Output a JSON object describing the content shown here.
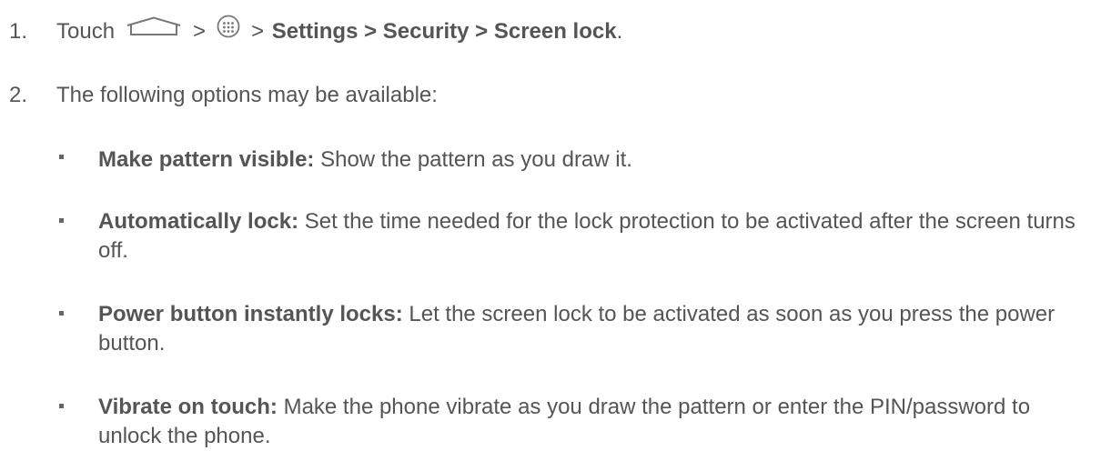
{
  "steps": [
    {
      "number": "1.",
      "prefix": "Touch",
      "sep1": ">",
      "sep2": ">",
      "path": "Settings > Security > Screen lock",
      "suffix": ".",
      "icons": [
        "home-icon",
        "apps-icon"
      ]
    },
    {
      "number": "2.",
      "text": "The following options may be available:"
    }
  ],
  "options": [
    {
      "term": "Make pattern visible:",
      "description": " Show the pattern as you draw it."
    },
    {
      "term": "Automatically lock:",
      "description": " Set the time needed for the lock protection to be activated after the screen turns off."
    },
    {
      "term": "Power button instantly locks:",
      "description": " Let the screen lock to be activated as soon as you press the power button."
    },
    {
      "term": "Vibrate on touch:",
      "description": " Make the phone vibrate as you draw the pattern or enter the PIN/password to unlock the phone."
    }
  ],
  "colors": {
    "text": "#555555",
    "icon": "#666666"
  }
}
